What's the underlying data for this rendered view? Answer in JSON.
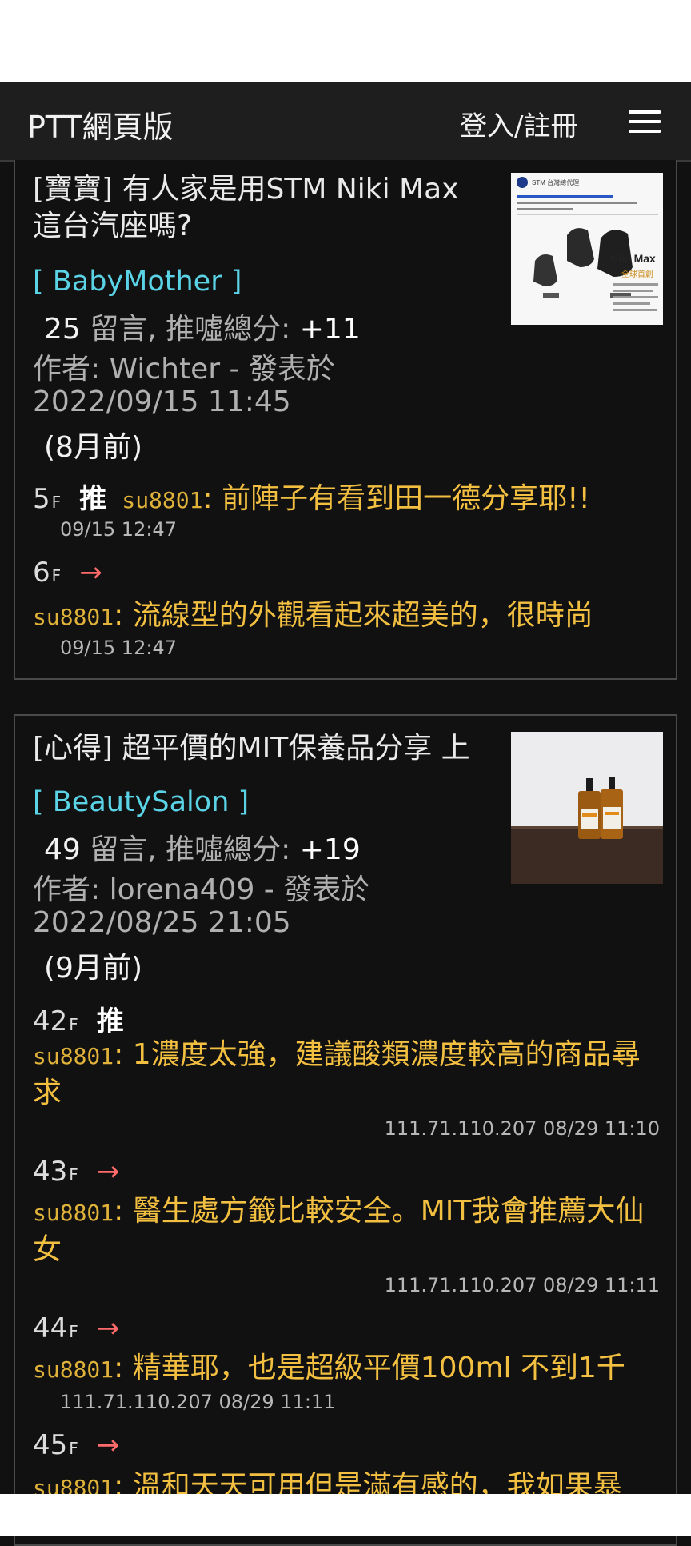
{
  "navbar": {
    "brand": "PTT網頁版",
    "login": "登入/註冊"
  },
  "posts": [
    {
      "title": "[寶寶] 有人家是用STM Niki Max 這台汽座嗎?",
      "board": "[ BabyMother ]",
      "comment_count": "25",
      "stats_label": "留言, 推噓總分:",
      "score": "+11",
      "author_line": "作者: Wichter - 發表於",
      "date": "2022/09/15 11:45",
      "ago": "(8月前)",
      "thumb_text": {
        "brand": "STM 台灣總代理",
        "model": "Niki Max",
        "tag": "全球首創"
      },
      "comments": [
        {
          "floor": "5",
          "floor_suffix": "F",
          "tag": "推",
          "user": "su8801",
          "text": ": 前陣子有看到田一德分享耶!!",
          "time": "09/15 12:47"
        },
        {
          "floor": "6",
          "floor_suffix": "F",
          "tag": "→",
          "user": "su8801",
          "text": ": 流線型的外觀看起來超美的，很時尚",
          "time": "09/15 12:47"
        }
      ]
    },
    {
      "title": "[心得] 超平價的MIT保養品分享 上",
      "board": "[ BeautySalon ]",
      "comment_count": "49",
      "stats_label": "留言, 推噓總分:",
      "score": "+19",
      "author_line": "作者: lorena409 - 發表於",
      "date": "2022/08/25 21:05",
      "ago": "(9月前)",
      "comments": [
        {
          "floor": "42",
          "floor_suffix": "F",
          "tag": "推",
          "user": "su8801",
          "text": ": 1濃度太強，建議酸類濃度較高的商品尋求",
          "time": "111.71.110.207 08/29 11:10"
        },
        {
          "floor": "43",
          "floor_suffix": "F",
          "tag": "→",
          "user": "su8801",
          "text": ": 醫生處方籤比較安全。MIT我會推薦大仙女",
          "time": "111.71.110.207 08/29 11:11"
        },
        {
          "floor": "44",
          "floor_suffix": "F",
          "tag": "→",
          "user": "su8801",
          "text": ": 精華耶，也是超級平價100ml 不到1千",
          "time": "111.71.110.207 08/29 11:11"
        },
        {
          "floor": "45",
          "floor_suffix": "F",
          "tag": "→",
          "user": "su8801",
          "text": ": 溫和天天可用但是滿有感的，我如果暴",
          "time": ""
        }
      ]
    }
  ],
  "colors": {
    "background": "#111111",
    "navbar": "#1e1e1e",
    "board": "#5bd3e6",
    "comment": "#f2bf41",
    "arrow": "#ff6a6a"
  }
}
